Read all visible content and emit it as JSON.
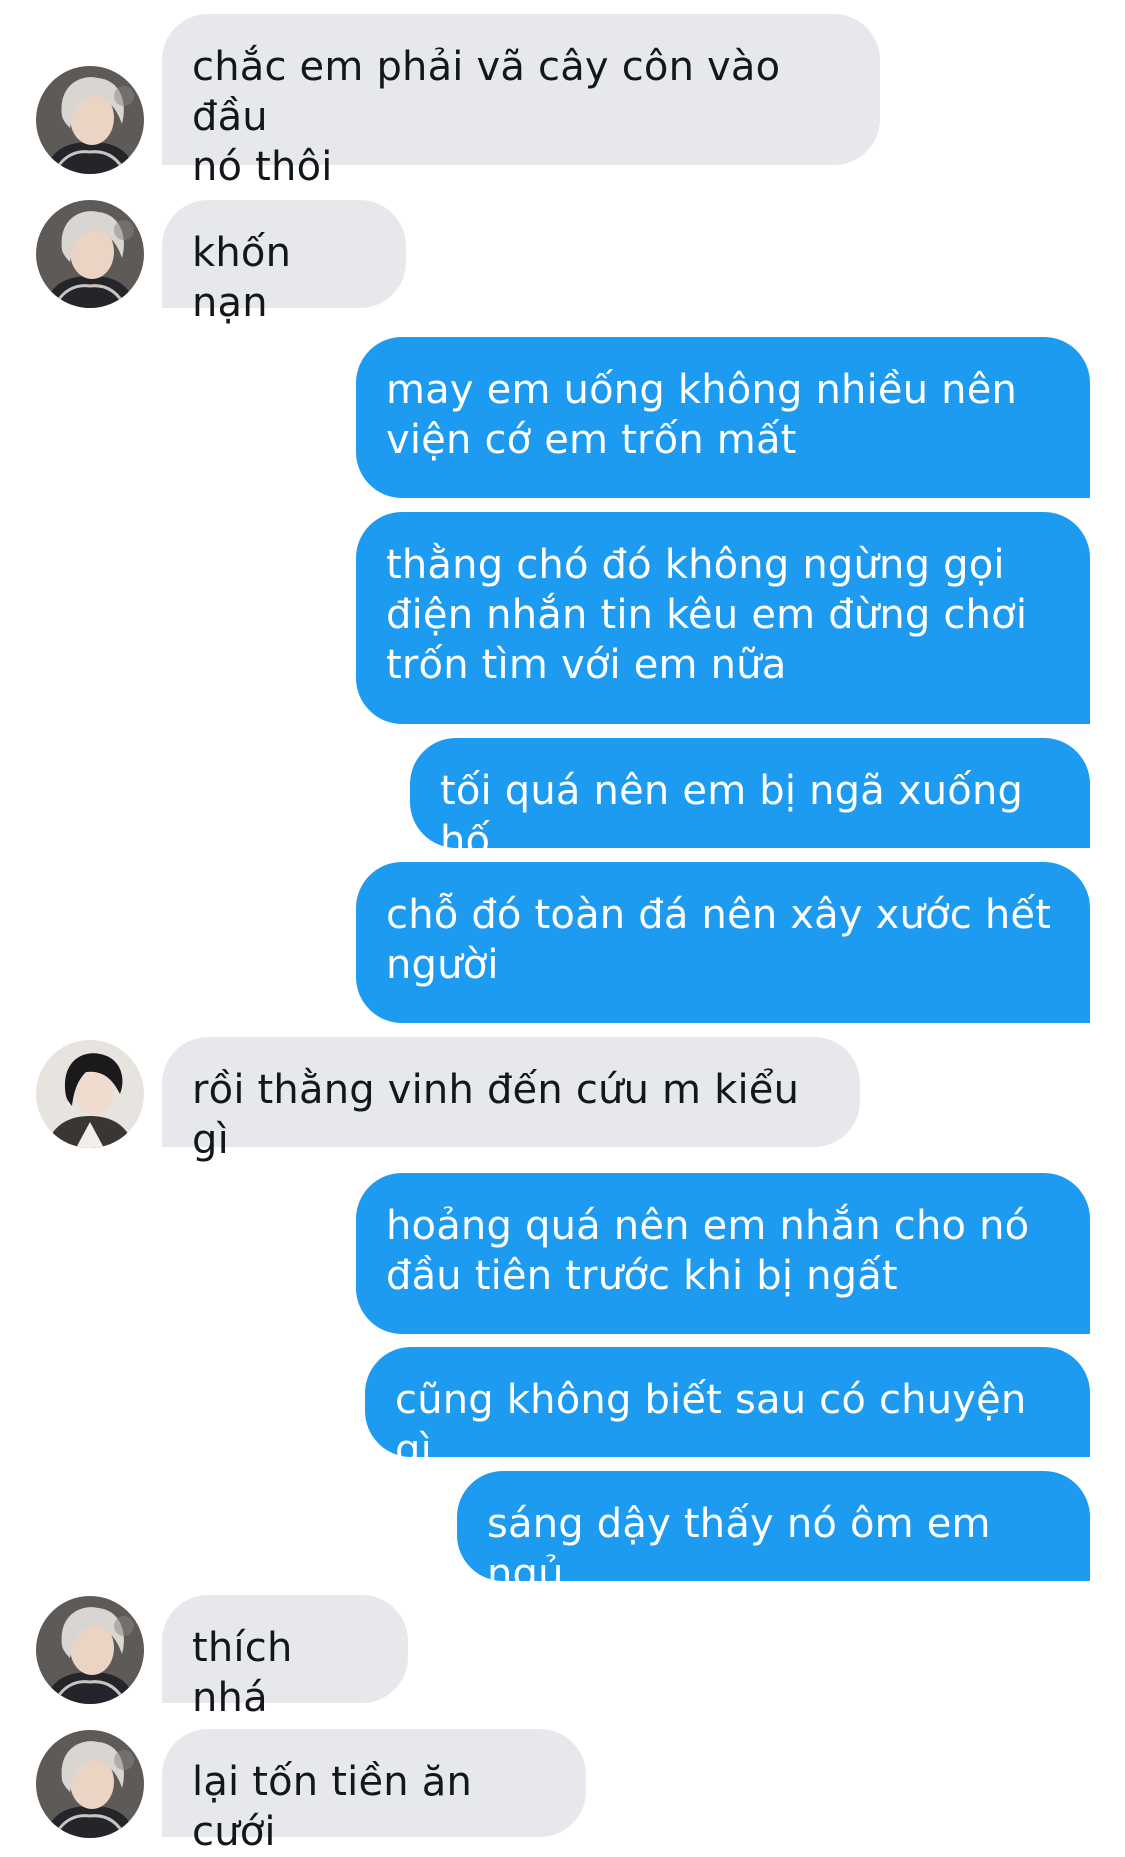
{
  "messages": [
    {
      "side": "in",
      "avatar": "silver-hair",
      "text": "chắc em phải vã cây côn vào đầu\nnó thôi"
    },
    {
      "side": "in",
      "avatar": "silver-hair",
      "text": "khốn nạn"
    },
    {
      "side": "out",
      "text": "may em uống không nhiều nên\nviện cớ em trốn mất"
    },
    {
      "side": "out",
      "text": "thằng chó đó không ngừng gọi\nđiện nhắn tin kêu em đừng chơi\ntrốn tìm với em nữa"
    },
    {
      "side": "out",
      "text": "tối quá nên em bị ngã xuống hố"
    },
    {
      "side": "out",
      "text": "chỗ đó toàn đá nên xây xước hết\nngười"
    },
    {
      "side": "in",
      "avatar": "dark-hair",
      "text": "rồi thằng vinh đến cứu m kiểu gì"
    },
    {
      "side": "out",
      "text": "hoảng quá nên em nhắn cho nó\nđầu tiên trước khi bị ngất"
    },
    {
      "side": "out",
      "text": "cũng không biết sau có chuyện gì"
    },
    {
      "side": "out",
      "text": "sáng dậy thấy nó ôm em ngủ"
    },
    {
      "side": "in",
      "avatar": "silver-hair",
      "text": "thích nhá"
    },
    {
      "side": "in",
      "avatar": "silver-hair",
      "text": "lại tốn tiền ăn cưới"
    }
  ],
  "colors": {
    "incoming_bubble": "#e6e8ec",
    "outgoing_bubble": "#1d9bf0",
    "incoming_text": "#14171a",
    "outgoing_text": "#ffffff"
  }
}
